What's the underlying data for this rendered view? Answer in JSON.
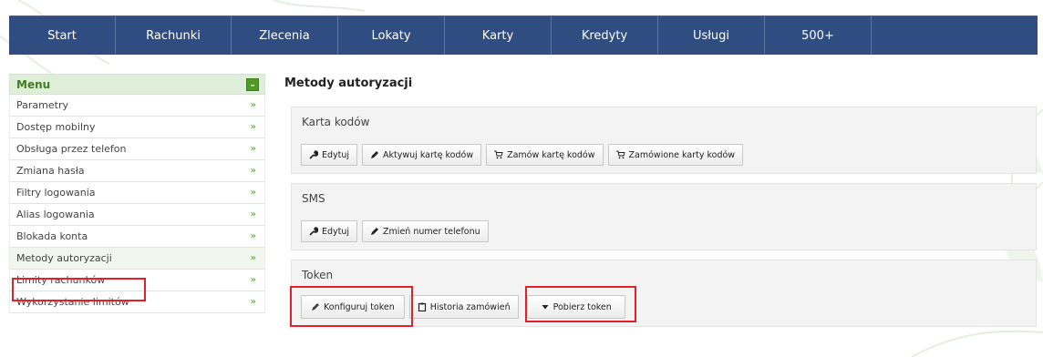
{
  "topnav": {
    "tabs": [
      "Start",
      "Rachunki",
      "Zlecenia",
      "Lokaty",
      "Karty",
      "Kredyty",
      "Usługi",
      "500+"
    ]
  },
  "menu": {
    "title": "Menu",
    "collapse_symbol": "-",
    "items": [
      "Parametry",
      "Dostęp mobilny",
      "Obsługa przez telefon",
      "Zmiana hasła",
      "Filtry logowania",
      "Alias logowania",
      "Blokada konta",
      "Metody autoryzacji",
      "Limity rachunków",
      "Wykorzystanie limitów"
    ],
    "active_item": "Metody autoryzacji",
    "chevron": "»"
  },
  "page": {
    "title": "Metody autoryzacji"
  },
  "sections": {
    "card": {
      "title": "Karta kodów",
      "buttons": [
        "Edytuj",
        "Aktywuj kartę kodów",
        "Zamów kartę kodów",
        "Zamówione karty kodów"
      ]
    },
    "sms": {
      "title": "SMS",
      "buttons": [
        "Edytuj",
        "Zmień numer telefonu"
      ]
    },
    "token": {
      "title": "Token",
      "buttons": [
        "Konfiguruj token",
        "Historia zamówień",
        "Pobierz token"
      ]
    }
  },
  "colors": {
    "nav_bg": "#2f4d80",
    "menu_header_bg": "#dfeed8",
    "menu_title": "#3f7f1e",
    "highlight": "#e0202a"
  }
}
